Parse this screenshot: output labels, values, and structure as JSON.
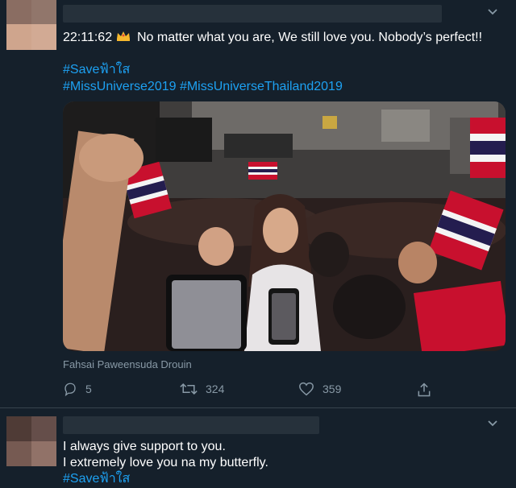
{
  "tweet1": {
    "time": "22:11:62",
    "crown_icon": "crown-icon",
    "text": "No matter what you are, We still love you. Nobody’s perfect!!",
    "hashtags_line1": "#Saveฟ้าใส",
    "hashtags_line2": "#MissUniverse2019 #MissUniverseThailand2019",
    "image_credit": "Fahsai Paweensuda Drouin",
    "actions": {
      "reply_count": "5",
      "retweet_count": "324",
      "like_count": "359"
    }
  },
  "tweet2": {
    "line1": "I always give support to you.",
    "line2": "I extremely love you na my butterfly.",
    "hashtag": "#Saveฟ้าใส"
  },
  "colors": {
    "background": "#15202b",
    "accent": "#1da1f2",
    "secondary_text": "#8899a6",
    "divider": "#38444d"
  }
}
